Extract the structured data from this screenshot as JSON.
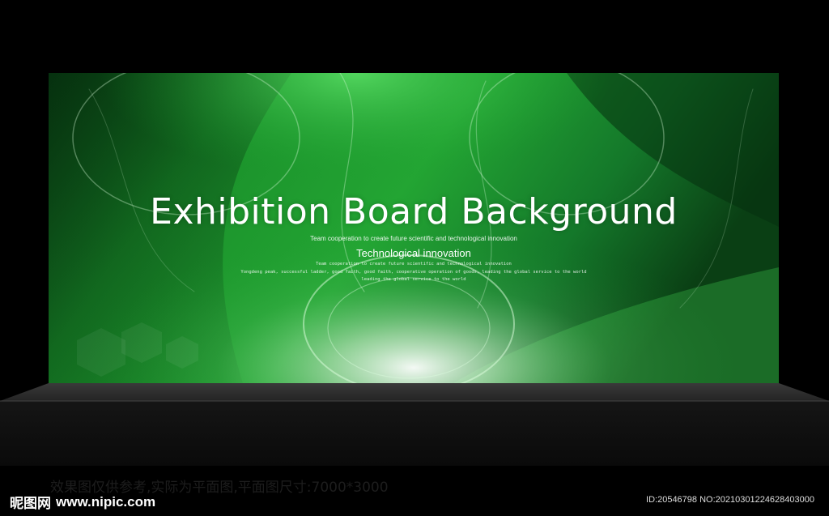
{
  "board": {
    "headline": "Exhibition Board Background",
    "tagline_1": "Team cooperation to create future scientific and technological innovation",
    "subheadline": "Technological innovation",
    "tagline_2": "Team cooperation to create future scientific and technological innovation",
    "tagline_3": "Yongdeng peak, successful ladder, good faith, good faith, cooperative operation of goods, leading the global service to the world",
    "tagline_4": "leading the global service to the world"
  },
  "footer": {
    "notice": "效果图仅供参考,实际为平面图,平面图尺寸:7000*3000",
    "brand": "昵图网",
    "url": "www.nipic.com",
    "image_id": "ID:20546798 NO:20210301224628403000"
  },
  "colors": {
    "background": "#000000",
    "board_green": "#1a9e2c",
    "stage": "#2a2a2a"
  }
}
